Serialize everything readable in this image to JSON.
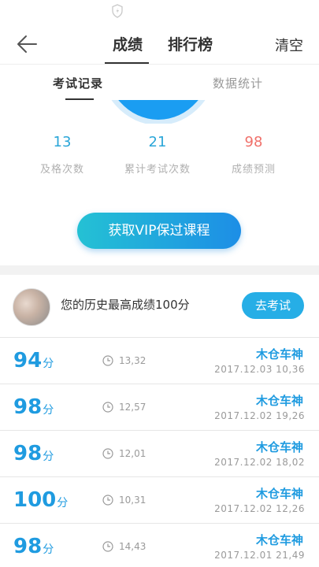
{
  "header": {
    "tabs": [
      "成绩",
      "排行榜"
    ],
    "clear_label": "清空"
  },
  "subtabs": [
    "考试记录",
    "数据统计"
  ],
  "stats": [
    {
      "value": "13",
      "label": "及格次数"
    },
    {
      "value": "21",
      "label": "累计考试次数"
    },
    {
      "value": "98",
      "label": "成绩预测"
    }
  ],
  "vip_button": "获取VIP保过课程",
  "best": {
    "text": "您的历史最高成绩100分",
    "button": "去考试"
  },
  "records": [
    {
      "score": "94",
      "unit": "分",
      "duration": "13,32",
      "user": "木仓车神",
      "date": "2017.12.03  10,36"
    },
    {
      "score": "98",
      "unit": "分",
      "duration": "12,57",
      "user": "木仓车神",
      "date": "2017.12.02  19,26"
    },
    {
      "score": "98",
      "unit": "分",
      "duration": "12,01",
      "user": "木仓车神",
      "date": "2017.12.02  18,02"
    },
    {
      "score": "100",
      "unit": "分",
      "duration": "10,31",
      "user": "木仓车神",
      "date": "2017.12.02  12,26"
    },
    {
      "score": "98",
      "unit": "分",
      "duration": "14,43",
      "user": "木仓车神",
      "date": "2017.12.01  21,49"
    }
  ],
  "colors": {
    "accent": "#1f9be0",
    "predict": "#f0706a",
    "vip_gradient_start": "#24c1d4",
    "vip_gradient_end": "#1d8ee6"
  }
}
